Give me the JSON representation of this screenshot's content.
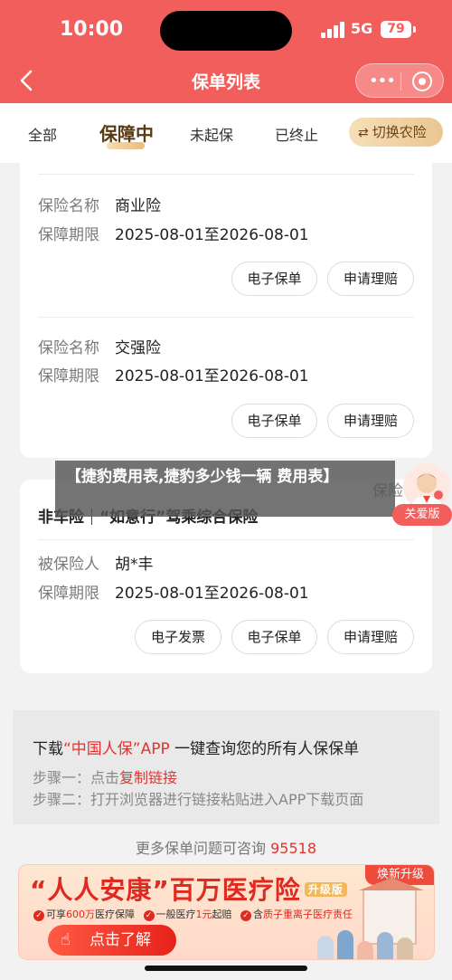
{
  "status_bar": {
    "time": "10:00",
    "network": "5G",
    "battery": "79"
  },
  "navbar": {
    "title": "保单列表"
  },
  "tabs": [
    {
      "label": "全部",
      "active": false
    },
    {
      "label": "保障中",
      "active": true
    },
    {
      "label": "未起保",
      "active": false
    },
    {
      "label": "已终止",
      "active": false
    }
  ],
  "switch_button": {
    "label": "切换农险"
  },
  "policy_card_1": {
    "entries": [
      {
        "name_label": "保险名称",
        "name_value": "商业险",
        "period_label": "保障期限",
        "period_value": "2025-08-01至2026-08-01",
        "buttons": [
          "电子保单",
          "申请理赔"
        ]
      },
      {
        "name_label": "保险名称",
        "name_value": "交强险",
        "period_label": "保障期限",
        "period_value": "2025-08-01至2026-08-01",
        "buttons": [
          "电子保单",
          "申请理赔"
        ]
      }
    ]
  },
  "policy_card_2": {
    "title_left": "非车险",
    "title_right": "“如意行”驾乘综合保险",
    "insured_label": "被保险人",
    "insured_value": "胡*丰",
    "period_label": "保障期限",
    "period_value": "2025-08-01至2026-08-01",
    "buttons": [
      "电子发票",
      "电子保单",
      "申请理赔"
    ]
  },
  "overlay": {
    "text": "【捷豹费用表,捷豹多少钱一辆 费用表】",
    "peek_text": "保险"
  },
  "care_mode": {
    "label": "关爱版"
  },
  "download": {
    "title_prefix": "下载",
    "title_app": "“中国人保”APP",
    "title_suffix": " 一键查询您的所有人保保单",
    "step1_prefix": "步骤一：点击",
    "step1_link": "复制链接",
    "step2": "步骤二：打开浏览器进行链接粘贴进入APP下载页面"
  },
  "consult": {
    "text": "更多保单问题可咨询 ",
    "phone": "95518"
  },
  "ad": {
    "title": "“人人安康”百万医疗险",
    "badge": "升级版",
    "tag": "焕新升级",
    "feature1_prefix": "可享",
    "feature1_hl": "600万",
    "feature1_suffix": "医疗保障",
    "feature2_prefix": "一般医疗",
    "feature2_hl": "1元",
    "feature2_suffix": "起赔",
    "feature3_prefix": "含",
    "feature3_hl": "质子重离子医疗责任",
    "button": "点击了解"
  },
  "colors": {
    "brand_red": "#f25e5c",
    "gold": "#eac690",
    "text_red": "#e6322e"
  }
}
